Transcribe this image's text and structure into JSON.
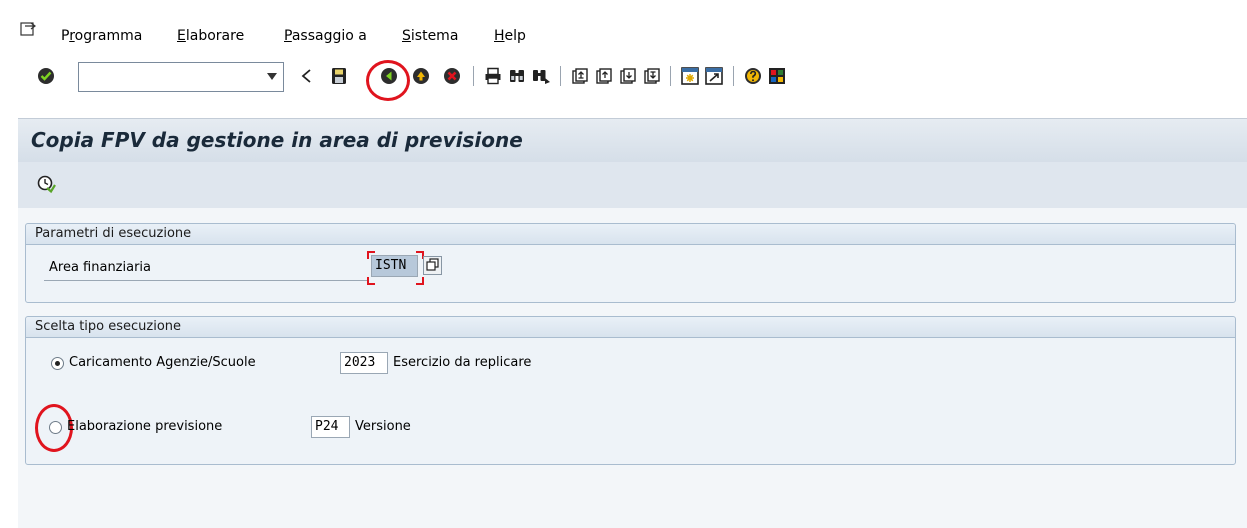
{
  "menubar": {
    "items": [
      {
        "prefix": "P",
        "underlined": "r",
        "rest": "ogramma"
      },
      {
        "prefix": "",
        "underlined": "E",
        "rest": "laborare"
      },
      {
        "prefix": "",
        "underlined": "P",
        "rest": "assaggio a"
      },
      {
        "prefix": "",
        "underlined": "S",
        "rest": "istema"
      },
      {
        "prefix": "",
        "underlined": "H",
        "rest": "elp"
      }
    ]
  },
  "toolbar": {
    "command_value": "",
    "icons": [
      "enter-icon",
      "back-arrow-icon",
      "save-icon",
      "back-icon",
      "exit-icon",
      "cancel-icon",
      "print-icon",
      "find-icon",
      "find-next-icon",
      "first-page-icon",
      "previous-page-icon",
      "next-page-icon",
      "last-page-icon",
      "create-session-icon",
      "shortcut-icon",
      "help-icon",
      "layout-icon"
    ]
  },
  "header": {
    "title": "Copia FPV da gestione in area di previsione"
  },
  "params": {
    "header": "Parametri di esecuzione",
    "area_label": "Area finanziaria",
    "area_value": "ISTN"
  },
  "exec": {
    "header": "Scelta tipo esecuzione",
    "option1_label": "Caricamento Agenzie/Scuole",
    "year_value": "2023",
    "year_label": "Esercizio da replicare",
    "option2_label": "Elaborazione previsione",
    "version_value": "P24",
    "version_label": "Versione"
  },
  "colors": {
    "highlight_ring": "#e0141e",
    "title_band": "#dfe6ee",
    "group_border": "#a9bccf"
  }
}
